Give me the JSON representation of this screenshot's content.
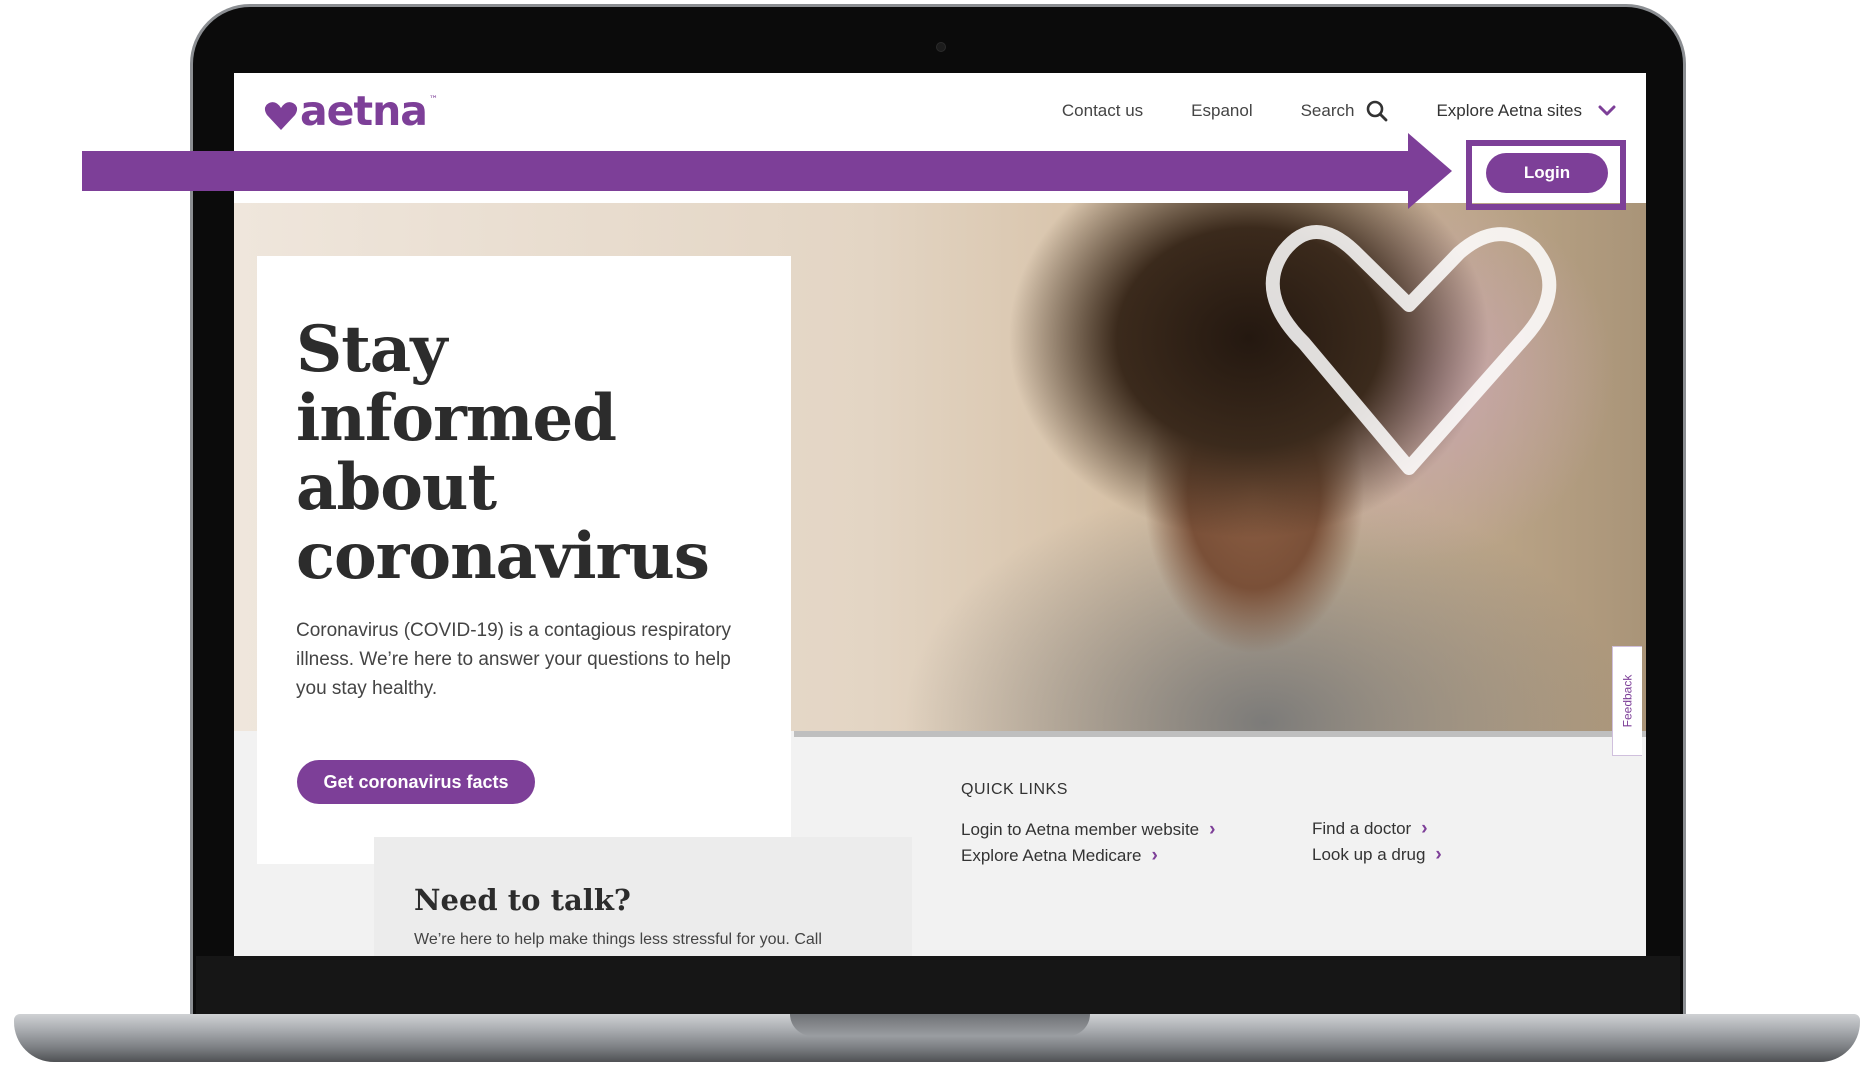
{
  "brand": {
    "logo_text": "aetna",
    "logo_tm": "™",
    "accent_color": "#7d3f98"
  },
  "nav": {
    "contact": "Contact us",
    "espanol": "Espanol",
    "search_label": "Search",
    "search_icon": "search-icon",
    "explore": "Explore Aetna sites",
    "explore_icon": "chevron-down-icon",
    "login": "Login"
  },
  "hero": {
    "title_lines": [
      "Stay",
      "informed",
      "about",
      "coronavirus"
    ],
    "body": "Coronavirus (COVID-19) is a contagious respiratory illness. We’re here to answer your questions to help you stay healthy.",
    "cta": "Get coronavirus facts"
  },
  "talk": {
    "title": "Need to talk?",
    "body": "We’re here to help make things less stressful for you. Call"
  },
  "quick_links": {
    "heading": "QUICK LINKS",
    "items": [
      {
        "label": "Login to Aetna member website"
      },
      {
        "label": "Explore Aetna Medicare"
      },
      {
        "label": "Find a doctor"
      },
      {
        "label": "Look up a drug"
      }
    ],
    "chevron": "›"
  },
  "feedback": {
    "label": "Feedback"
  }
}
